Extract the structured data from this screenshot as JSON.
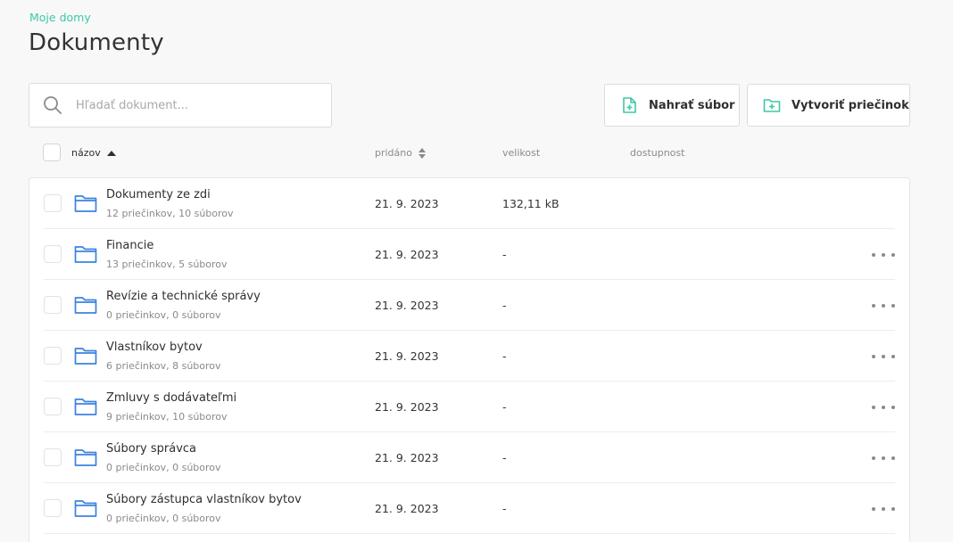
{
  "breadcrumb": "Moje domy",
  "page_title": "Dokumenty",
  "search": {
    "placeholder": "Hľadať dokument..."
  },
  "toolbar": {
    "upload_label": "Nahrať súbor",
    "create_folder_label": "Vytvoriť priečinok"
  },
  "columns": {
    "name": "názov",
    "added": "pridáno",
    "size": "velikost",
    "availability": "dostupnost"
  },
  "accent_color": "#3ec7a6",
  "folder_color": "#3b82e0",
  "rows": [
    {
      "name": "Dokumenty ze zdi",
      "meta": "12 priečinkov, 10 súborov",
      "date": "21. 9. 2023",
      "size": "132,11 kB",
      "has_menu": false
    },
    {
      "name": "Financie",
      "meta": "13 priečinkov, 5 súborov",
      "date": "21. 9. 2023",
      "size": "-",
      "has_menu": true
    },
    {
      "name": "Revízie a technické správy",
      "meta": "0 priečinkov, 0 súborov",
      "date": "21. 9. 2023",
      "size": "-",
      "has_menu": true
    },
    {
      "name": "Vlastníkov bytov",
      "meta": "6 priečinkov, 8 súborov",
      "date": "21. 9. 2023",
      "size": "-",
      "has_menu": true
    },
    {
      "name": "Zmluvy s dodávateľmi",
      "meta": "9 priečinkov, 10 súborov",
      "date": "21. 9. 2023",
      "size": "-",
      "has_menu": true
    },
    {
      "name": "Súbory správca",
      "meta": "0 priečinkov, 0 súborov",
      "date": "21. 9. 2023",
      "size": "-",
      "has_menu": true
    },
    {
      "name": "Súbory zástupca vlastníkov bytov",
      "meta": "0 priečinkov, 0 súborov",
      "date": "21. 9. 2023",
      "size": "-",
      "has_menu": true
    }
  ]
}
